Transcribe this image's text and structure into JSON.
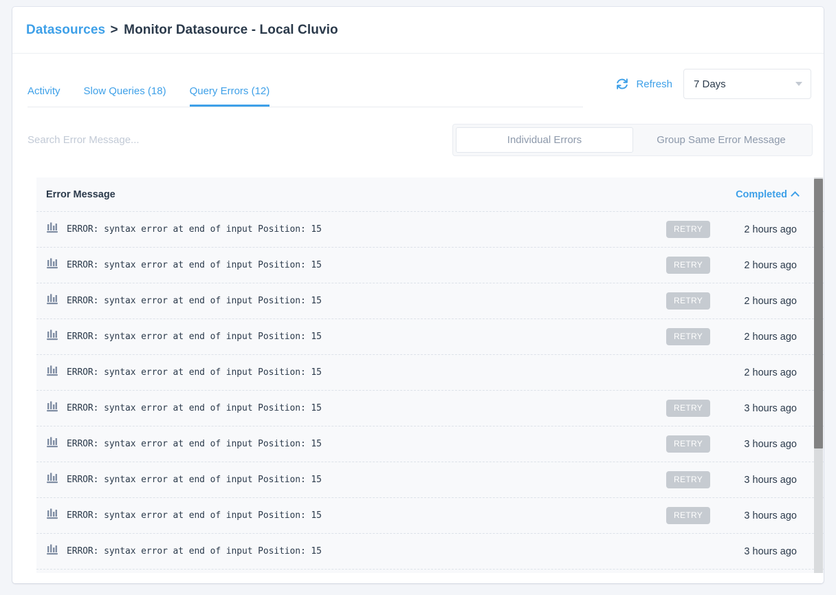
{
  "breadcrumb": {
    "root": "Datasources",
    "separator": ">",
    "current": "Monitor Datasource - Local Cluvio"
  },
  "tabs": [
    {
      "label": "Activity",
      "active": false
    },
    {
      "label": "Slow Queries (18)",
      "active": false
    },
    {
      "label": "Query Errors (12)",
      "active": true
    }
  ],
  "toolbar": {
    "refresh_label": "Refresh",
    "refresh_icon": "refresh-icon",
    "range_value": "7 Days",
    "range_caret_icon": "chevron-down-icon"
  },
  "filters": {
    "search_placeholder": "Search Error Message...",
    "search_value": "",
    "segments": [
      {
        "label": "Individual Errors",
        "active": true
      },
      {
        "label": "Group Same Error Message",
        "active": false
      }
    ]
  },
  "table": {
    "columns": {
      "message": "Error Message",
      "status": "Completed",
      "sort_icon": "chevron-up-icon"
    },
    "row_icon": "bar-chart-icon",
    "retry_label": "RETRY",
    "rows": [
      {
        "message": "ERROR: syntax error at end of input Position: 15",
        "retry": "RETRY",
        "time": "2 hours ago"
      },
      {
        "message": "ERROR: syntax error at end of input Position: 15",
        "retry": "RETRY",
        "time": "2 hours ago"
      },
      {
        "message": "ERROR: syntax error at end of input Position: 15",
        "retry": "RETRY",
        "time": "2 hours ago"
      },
      {
        "message": "ERROR: syntax error at end of input Position: 15",
        "retry": "RETRY",
        "time": "2 hours ago"
      },
      {
        "message": "ERROR: syntax error at end of input Position: 15",
        "retry": "",
        "time": "2 hours ago"
      },
      {
        "message": "ERROR: syntax error at end of input Position: 15",
        "retry": "RETRY",
        "time": "3 hours ago"
      },
      {
        "message": "ERROR: syntax error at end of input Position: 15",
        "retry": "RETRY",
        "time": "3 hours ago"
      },
      {
        "message": "ERROR: syntax error at end of input Position: 15",
        "retry": "RETRY",
        "time": "3 hours ago"
      },
      {
        "message": "ERROR: syntax error at end of input Position: 15",
        "retry": "RETRY",
        "time": "3 hours ago"
      },
      {
        "message": "ERROR: syntax error at end of input Position: 15",
        "retry": "",
        "time": "3 hours ago"
      }
    ]
  },
  "colors": {
    "accent": "#3ea0e8",
    "text": "#2b3a4b",
    "muted": "#8d99ab",
    "badge": "#c6cbd1",
    "page_bg": "#f3f5f9",
    "table_bg": "#f8f9fb"
  }
}
